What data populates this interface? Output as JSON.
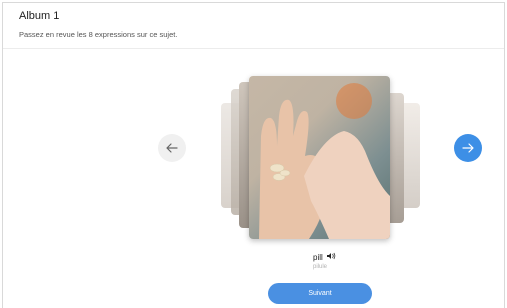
{
  "header": {
    "title": "Album 1",
    "subtitle": "Passez en revue les 8 expressions sur ce sujet."
  },
  "carousel": {
    "prev_icon": "arrow-left-icon",
    "next_icon": "arrow-right-icon",
    "accent_color": "#3d8fe6"
  },
  "card": {
    "word": "pill",
    "translation": "pilule",
    "audio_icon": "speaker-icon"
  },
  "footer": {
    "next_label": "Suivant"
  }
}
